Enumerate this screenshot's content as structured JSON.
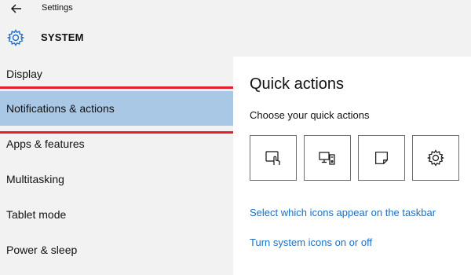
{
  "window": {
    "app_title": "Settings",
    "back_icon": "back-arrow-icon"
  },
  "section": {
    "icon": "gear-icon",
    "title": "SYSTEM"
  },
  "sidebar": {
    "items": [
      {
        "label": "Display",
        "selected": false
      },
      {
        "label": "Notifications & actions",
        "selected": true
      },
      {
        "label": "Apps & features",
        "selected": false
      },
      {
        "label": "Multitasking",
        "selected": false
      },
      {
        "label": "Tablet mode",
        "selected": false
      },
      {
        "label": "Power & sleep",
        "selected": false
      }
    ]
  },
  "content": {
    "title": "Quick actions",
    "subtitle": "Choose your quick actions",
    "quick_actions": [
      {
        "icon": "tablet-mode-icon"
      },
      {
        "icon": "connect-display-icon"
      },
      {
        "icon": "note-icon"
      },
      {
        "icon": "settings-gear-icon"
      }
    ],
    "links": [
      "Select which icons appear on the taskbar",
      "Turn system icons on or off"
    ]
  },
  "colors": {
    "selected_bg": "#a8c8e6",
    "highlight_border": "#e0212b",
    "link": "#1c6fc4",
    "sidebar_bg": "#f2f2f2"
  }
}
